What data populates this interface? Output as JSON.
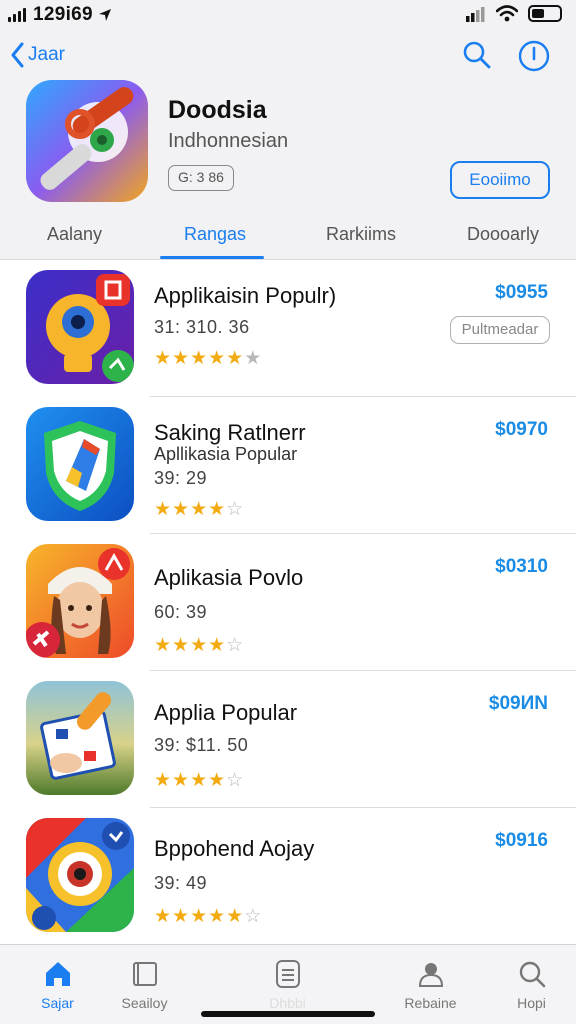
{
  "status_bar": {
    "time": "129i69"
  },
  "header": {
    "back_label": "Jaar",
    "app_name": "Doodsia",
    "app_subtitle": "Indhonnesian",
    "chip_label": "G: 3 86",
    "action_label": "Eooiimo"
  },
  "tabs": [
    {
      "label": "Aalany",
      "active": false
    },
    {
      "label": "Rangas",
      "active": true
    },
    {
      "label": "Rarkiims",
      "active": false
    },
    {
      "label": "Doooarly",
      "active": false
    }
  ],
  "apps": [
    {
      "title": "Applikaisin Populr)",
      "subtitle": "",
      "meta": "31: 310. 36",
      "price": "$0955",
      "button_label": "Pultmeadar",
      "rating": 4.5
    },
    {
      "title": "Saking Ratlnerr",
      "subtitle": "Apllikasia Popular",
      "meta": "39: 29",
      "price": "$0970",
      "button_label": "",
      "rating": 3.5
    },
    {
      "title": "Aplikasia Povlo",
      "subtitle": "",
      "meta": "60: 39",
      "price": "$0310",
      "button_label": "",
      "rating": 3.5
    },
    {
      "title": "Applia Popular",
      "subtitle": "",
      "meta": "39: $11. 50",
      "price": "$09ИN",
      "button_label": "",
      "rating": 3.5
    },
    {
      "title": "Bppohend Aojay",
      "subtitle": "",
      "meta": "39: 49",
      "price": "$0916",
      "button_label": "",
      "rating": 4.5
    }
  ],
  "tabbar": [
    {
      "label": "Sajar",
      "icon": "home-icon",
      "active": true
    },
    {
      "label": "Seailoy",
      "icon": "book-icon",
      "active": false
    },
    {
      "label": "Dhbbi",
      "icon": "list-icon",
      "active": false
    },
    {
      "label": "Rebaine",
      "icon": "profile-icon",
      "active": false
    },
    {
      "label": "Hopi",
      "icon": "search-icon",
      "active": false
    }
  ],
  "colors": {
    "accent": "#1a7ef0",
    "price": "#1a8ce6",
    "star": "#f2ab12"
  }
}
